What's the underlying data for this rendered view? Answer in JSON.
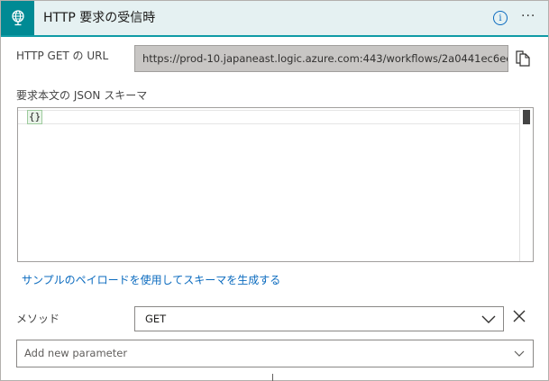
{
  "header": {
    "title": "HTTP 要求の受信時",
    "icon": "http-trigger-icon",
    "info_icon_glyph": "i",
    "more_icon_glyph": "···",
    "accent_color": "#008a94"
  },
  "url_field": {
    "label": "HTTP GET の URL",
    "value": "https://prod-10.japaneast.logic.azure.com:443/workflows/2a0441ec6ecb4...",
    "copy_icon": "copy-icon"
  },
  "schema": {
    "label": "要求本文の JSON スキーマ",
    "content": "{}"
  },
  "sample_link": "サンプルのペイロードを使用してスキーマを生成する",
  "method": {
    "label": "メソッド",
    "value": "GET"
  },
  "add_parameter": {
    "placeholder": "Add new parameter"
  }
}
